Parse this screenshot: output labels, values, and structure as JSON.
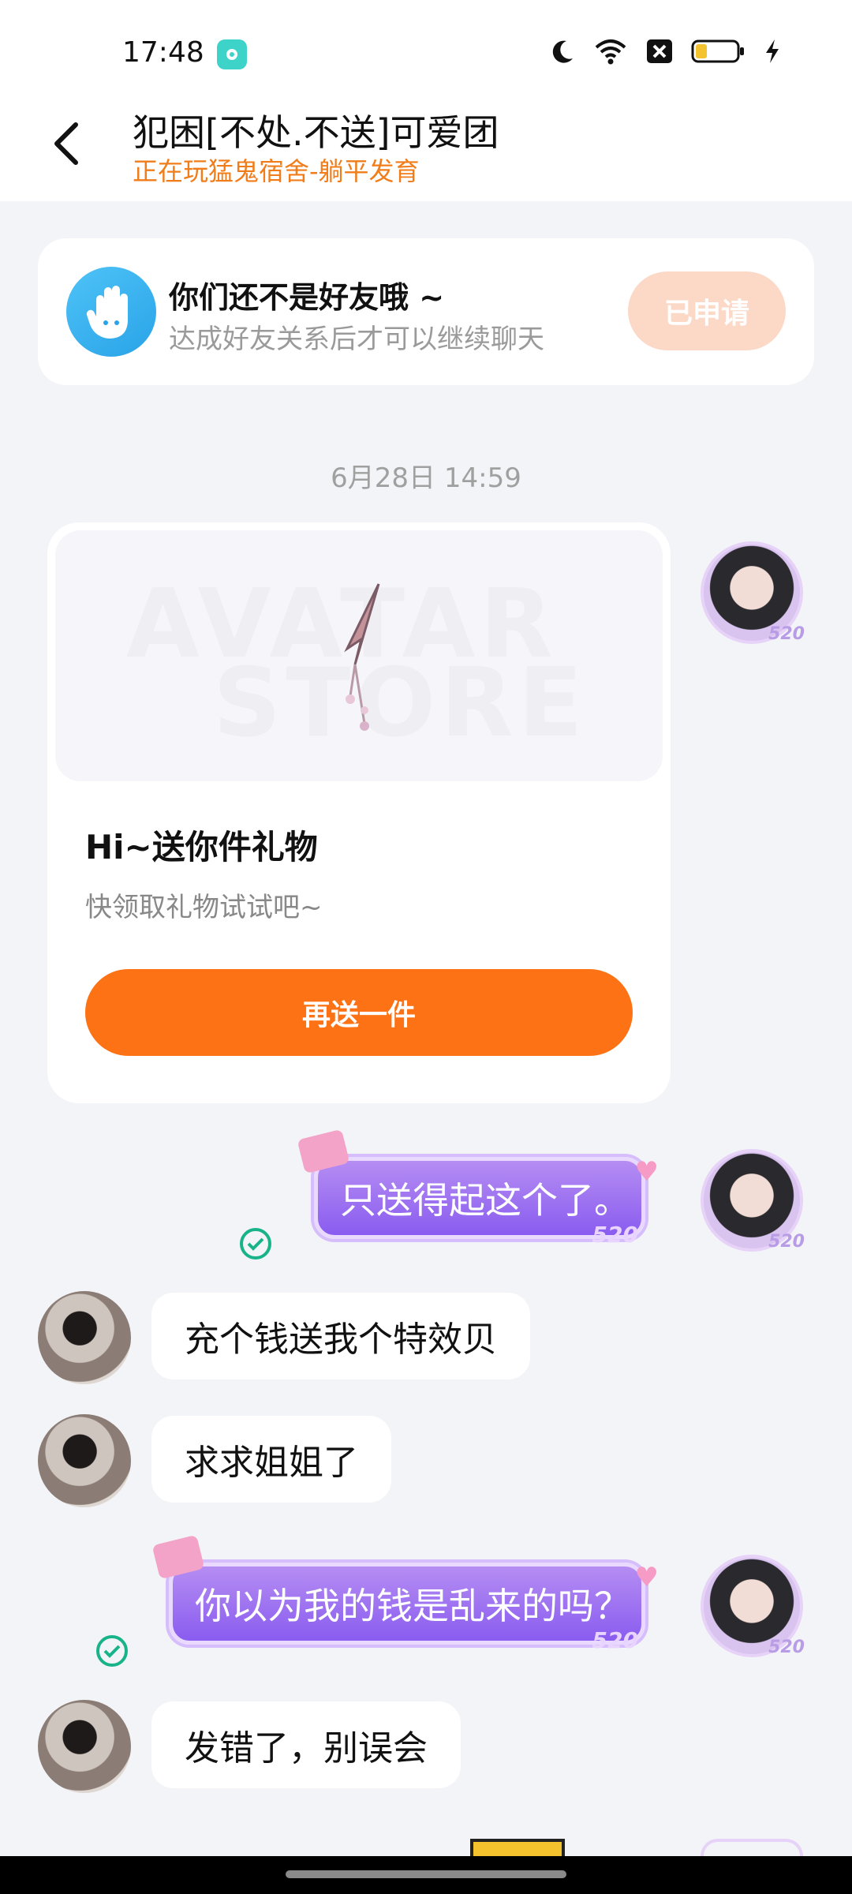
{
  "status_bar": {
    "time": "17:48"
  },
  "header": {
    "title": "犯困[不处.不送]可爱团",
    "subtitle": "正在玩猛鬼宿舍-躺平发育"
  },
  "friend_banner": {
    "title": "你们还不是好友哦 ~",
    "subtitle": "达成好友关系后才可以继续聊天",
    "button_label": "已申请"
  },
  "chat": {
    "timestamp": "6月28日 14:59",
    "gift_card": {
      "watermark_line1": "AVATAR",
      "watermark_line2": "STORE",
      "title": "Hi~送你件礼物",
      "description": "快领取礼物试试吧~",
      "button_label": "再送一件"
    },
    "bubble_tag": "520",
    "messages": [
      {
        "from": "me",
        "text": "只送得起这个了。"
      },
      {
        "from": "other",
        "text": "充个钱送我个特效贝"
      },
      {
        "from": "other",
        "text": "求求姐姐了"
      },
      {
        "from": "me",
        "text": "你以为我的钱是乱来的吗？"
      },
      {
        "from": "other",
        "text": "发错了，别误会"
      }
    ]
  },
  "colors": {
    "accent_orange": "#fd7214",
    "subtitle_orange": "#f07d1a",
    "applied_button": "#fcd9c7",
    "bubble_purple": "#8a5cf0",
    "sent_check_green": "#19b38a"
  }
}
